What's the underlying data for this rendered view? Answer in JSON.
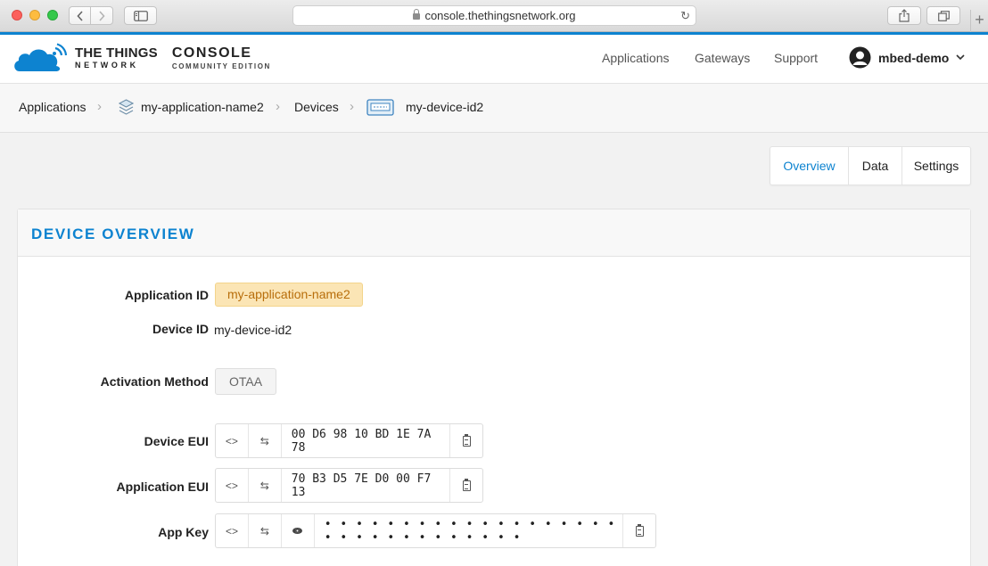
{
  "browser": {
    "url": "console.thethingsnetwork.org",
    "reload_icon": "↻",
    "new_tab_icon": "+"
  },
  "header": {
    "logo_line1": "THE THINGS",
    "logo_line2": "NETWORK",
    "console_line1": "CONSOLE",
    "console_line2": "COMMUNITY EDITION",
    "nav": {
      "applications": "Applications",
      "gateways": "Gateways",
      "support": "Support"
    },
    "user": "mbed-demo"
  },
  "breadcrumb": {
    "applications": "Applications",
    "application_name": "my-application-name2",
    "devices": "Devices",
    "device_id": "my-device-id2",
    "separator": "›"
  },
  "tabs": {
    "overview": "Overview",
    "data": "Data",
    "settings": "Settings",
    "active": "overview"
  },
  "panel": {
    "title": "DEVICE OVERVIEW",
    "application_id_label": "Application ID",
    "application_id": "my-application-name2",
    "device_id_label": "Device ID",
    "device_id": "my-device-id2",
    "activation_method_label": "Activation Method",
    "activation_method": "OTAA",
    "device_eui_label": "Device EUI",
    "device_eui": "00 D6 98 10 BD 1E 7A 78",
    "application_eui_label": "Application EUI",
    "application_eui": "70 B3 D5 7E D0 00 F7 13",
    "app_key_label": "App Key",
    "app_key": "• • • • • • • • • • • • • • • • • • • • • • • • • • • • • • • •"
  },
  "icons": {
    "code": "<>",
    "swap": "⇆"
  },
  "colors": {
    "accent": "#0d83d0",
    "badge_bg": "#fbe5b5",
    "badge_text": "#b86e0b"
  }
}
